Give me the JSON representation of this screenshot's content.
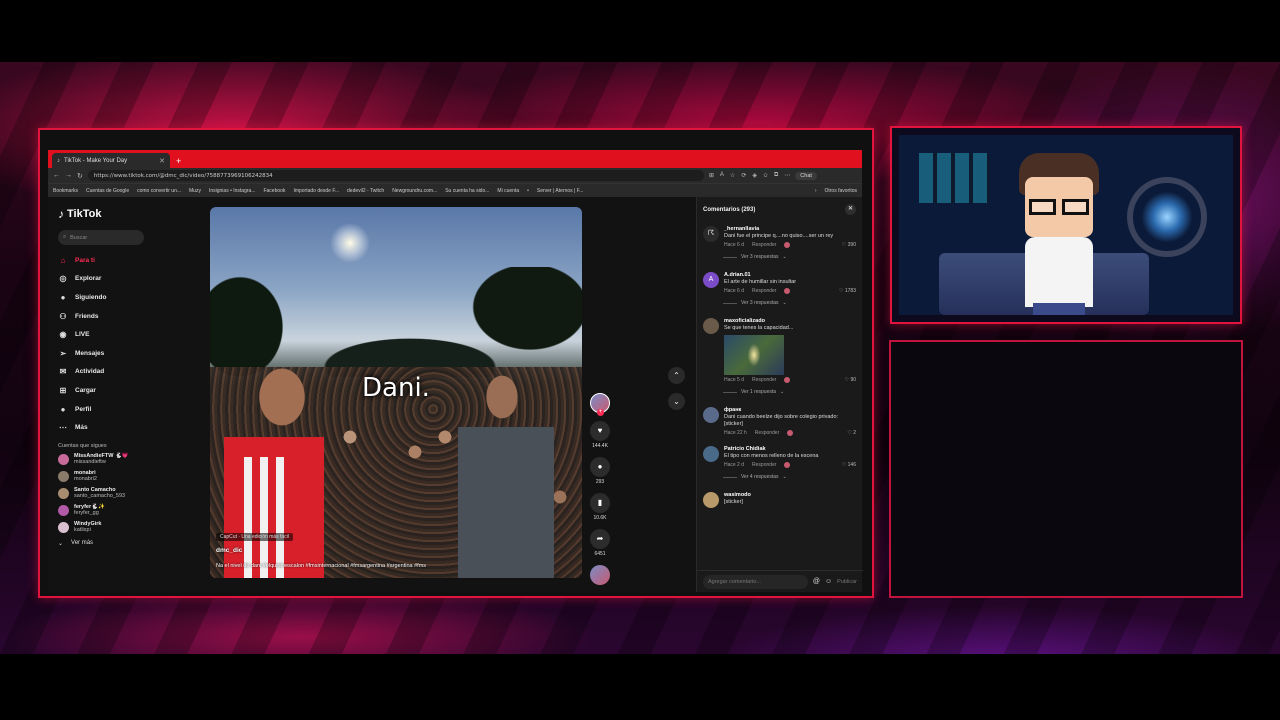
{
  "browser": {
    "tab_title": "TikTok - Make Your Day",
    "url": "https://www.tiktok.com/@dmc_dic/video/7588773969106242834",
    "chat_label": "Chat",
    "bookmarks": [
      "Bookmarks",
      "Cuentas de Google",
      "como convertir un...",
      "Muzy",
      "Insignias • Instagra...",
      "Facebook",
      "Importado desde F...",
      "dedevil2 - Twitch",
      "Newgroundru.com...",
      "Su cuenta ha sido...",
      "Mi cuenta",
      "•",
      "Server | Aternos | F..."
    ],
    "bookmarks_other": "Otros favoritos"
  },
  "tiktok": {
    "logo": "TikTok",
    "search_placeholder": "Buscar",
    "menu": [
      {
        "label": "Para ti",
        "icon": "home-icon"
      },
      {
        "label": "Explorar",
        "icon": "compass-icon"
      },
      {
        "label": "Siguiendo",
        "icon": "following-icon"
      },
      {
        "label": "Friends",
        "icon": "friends-icon"
      },
      {
        "label": "LIVE",
        "icon": "live-icon"
      },
      {
        "label": "Mensajes",
        "icon": "message-icon"
      },
      {
        "label": "Actividad",
        "icon": "activity-icon"
      },
      {
        "label": "Cargar",
        "icon": "upload-icon"
      },
      {
        "label": "Perfil",
        "icon": "profile-icon"
      },
      {
        "label": "Más",
        "icon": "more-icon"
      }
    ],
    "following_title": "Cuentas que sigues",
    "following": [
      {
        "name": "MissAndieFTW 🐇💗",
        "handle": "missandieftw"
      },
      {
        "name": "monabri",
        "handle": "monabri2"
      },
      {
        "name": "Santo Camacho",
        "handle": "santo_camacho_593"
      },
      {
        "name": "feryfer🐇✨",
        "handle": "feryfer_gg"
      },
      {
        "name": "WindyGirk",
        "handle": "katlispi"
      }
    ],
    "see_more": "Ver más"
  },
  "video": {
    "caption": "Dani.",
    "capcut": "CapCut · Una edición más fácil",
    "username": "dmc_dic",
    "description": "Na el nivel de dani #elquintoescalon #fmsinternacional #fmsargentina #argentina #fms",
    "likes": "144.4K",
    "comments": "293",
    "saves": "10.6K",
    "shares": "6451"
  },
  "comments": {
    "title": "Comentarios (293)",
    "reply_label": "Responder",
    "input_placeholder": "Agregar comentario...",
    "post_label": "Publicar",
    "items": [
      {
        "user": "_hernanllavia",
        "text": "Dani fue el principe q....no quiso....ser un rey",
        "time": "Hace 6 d",
        "likes": "390",
        "replies": "Ver 3 respuestas"
      },
      {
        "user": "A.drian.01",
        "text": "El arte de humillar sin insultar",
        "time": "Hace 6 d",
        "likes": "1783",
        "replies": "Ver 3 respuestas",
        "avatar": "A"
      },
      {
        "user": "maxoficializado",
        "text": "Se que tenes la capacidad...",
        "time": "Hace 5 d",
        "likes": "90",
        "replies": "Ver 1 respuesta"
      },
      {
        "user": "фрaнк",
        "text": "Dani cuando beelze dijo sobre colegio privado: [sticker]",
        "time": "Hace 22 h",
        "likes": "2"
      },
      {
        "user": "Patricio Chidiak",
        "text": "El tipo con menos relleno de la escena",
        "time": "Hace 2 d",
        "likes": "146",
        "replies": "Ver 4 respuestas"
      },
      {
        "user": "wasimodo",
        "text": "[sticker]"
      }
    ]
  },
  "colors": {
    "accent": "#fe2c55",
    "frame": "#e0143c",
    "tabbar": "#e0101e"
  }
}
